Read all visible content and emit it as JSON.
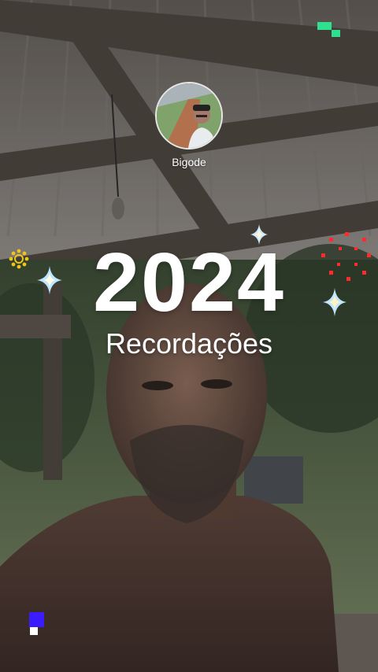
{
  "story": {
    "username": "Bigode",
    "year": "2024",
    "subtitle": "Recordações"
  },
  "icons": {
    "sparkle": "sparkle-icon",
    "sun_gear": "sun-gear-icon",
    "firework": "firework-icon",
    "pixel": "pixel-block-icon"
  },
  "colors": {
    "accent_green": "#2ee08f",
    "accent_blue": "#3a1cff",
    "accent_red": "#ff2a2a",
    "accent_yellow": "#f0c419"
  }
}
